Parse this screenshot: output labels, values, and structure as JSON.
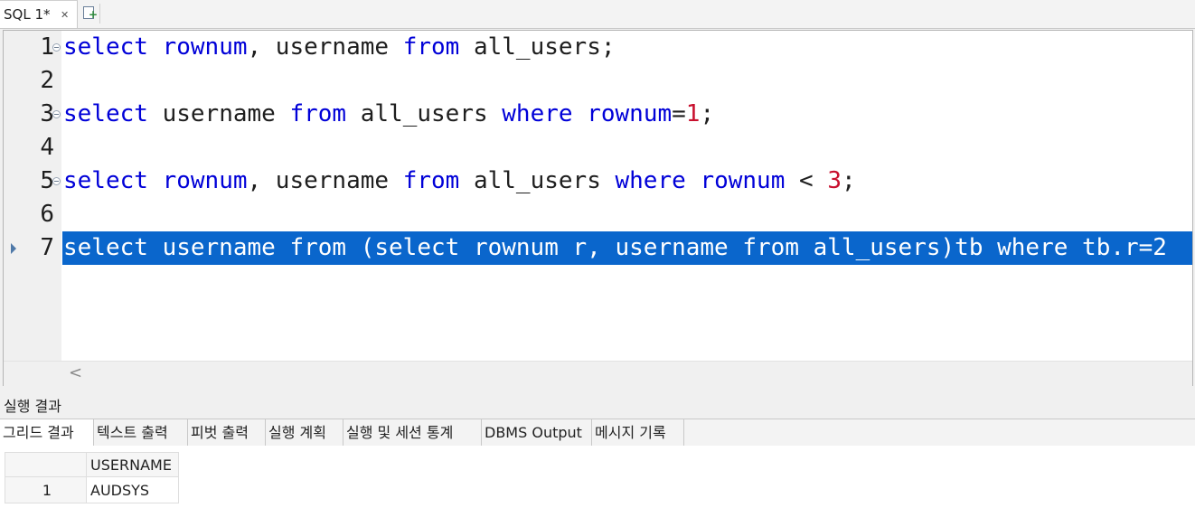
{
  "editor_tabs": {
    "active_label": "SQL 1*",
    "close_glyph": "✕",
    "new_tab_icon": "new-document-icon"
  },
  "editor": {
    "lines": [
      {
        "num": "1",
        "tokens": [
          {
            "t": "select",
            "c": "kw"
          },
          {
            "t": " "
          },
          {
            "t": "rownum",
            "c": "kw"
          },
          {
            "t": ", username "
          },
          {
            "t": "from",
            "c": "kw"
          },
          {
            "t": " all_users;"
          }
        ]
      },
      {
        "num": "2",
        "tokens": []
      },
      {
        "num": "3",
        "tokens": [
          {
            "t": "select",
            "c": "kw"
          },
          {
            "t": " username "
          },
          {
            "t": "from",
            "c": "kw"
          },
          {
            "t": " all_users "
          },
          {
            "t": "where",
            "c": "kw"
          },
          {
            "t": " "
          },
          {
            "t": "rownum",
            "c": "kw"
          },
          {
            "t": "="
          },
          {
            "t": "1",
            "c": "num"
          },
          {
            "t": ";"
          }
        ]
      },
      {
        "num": "4",
        "tokens": []
      },
      {
        "num": "5",
        "tokens": [
          {
            "t": "select",
            "c": "kw"
          },
          {
            "t": " "
          },
          {
            "t": "rownum",
            "c": "kw"
          },
          {
            "t": ", username "
          },
          {
            "t": "from",
            "c": "kw"
          },
          {
            "t": " all_users "
          },
          {
            "t": "where",
            "c": "kw"
          },
          {
            "t": " "
          },
          {
            "t": "rownum",
            "c": "kw"
          },
          {
            "t": " < "
          },
          {
            "t": "3",
            "c": "num"
          },
          {
            "t": ";"
          }
        ]
      },
      {
        "num": "6",
        "tokens": []
      },
      {
        "num": "7",
        "selected": true,
        "tokens": [
          {
            "t": "select username from (select rownum r, username from all_users)tb where tb.r=2"
          }
        ]
      }
    ],
    "scroll_left_glyph": "<"
  },
  "results": {
    "title": "실행 결과",
    "tabs": [
      {
        "label": "그리드 결과",
        "active": true
      },
      {
        "label": "텍스트 출력"
      },
      {
        "label": "피벗 출력"
      },
      {
        "label": "실행 계획"
      },
      {
        "label": "실행 및 세션 통계"
      },
      {
        "label": "DBMS Output"
      },
      {
        "label": "메시지 기록"
      }
    ],
    "grid": {
      "columns": [
        "USERNAME"
      ],
      "rows": [
        {
          "num": "1",
          "cells": [
            "AUDSYS"
          ]
        }
      ]
    }
  },
  "colors": {
    "keyword": "#0000d8",
    "number": "#c8102e",
    "selection": "#0a66cc"
  }
}
